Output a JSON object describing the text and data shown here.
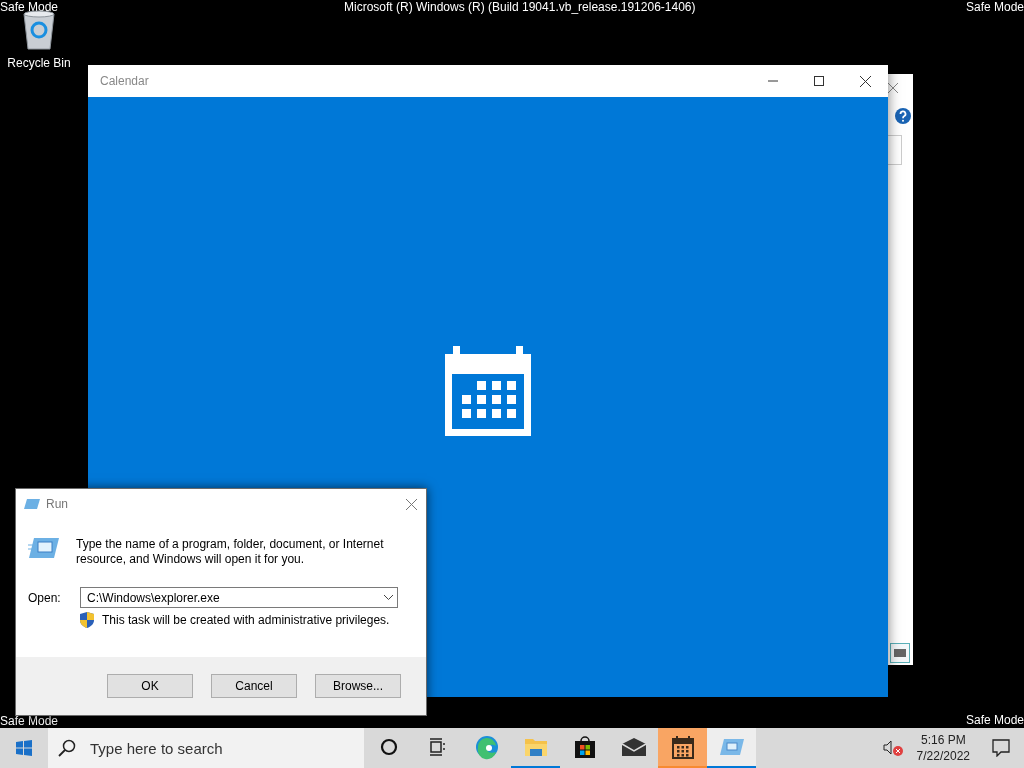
{
  "desktop": {
    "corner_labels": [
      "Safe Mode",
      "Safe Mode",
      "Safe Mode",
      "Safe Mode"
    ],
    "build_text": "Microsoft (R) Windows (R) (Build 19041.vb_release.191206-1406)",
    "icons": [
      {
        "label": "Recycle Bin"
      }
    ]
  },
  "calendar_window": {
    "title": "Calendar"
  },
  "run_dialog": {
    "title": "Run",
    "message": "Type the name of a program, folder, document, or Internet resource, and Windows will open it for you.",
    "open_label": "Open:",
    "open_value": "C:\\Windows\\explorer.exe",
    "admin_note": "This task will be created with administrative privileges.",
    "buttons": [
      "OK",
      "Cancel",
      "Browse..."
    ]
  },
  "taskbar": {
    "search_placeholder": "Type here to search",
    "apps": [
      {
        "kind": "cortana",
        "running": false,
        "flashing": false,
        "selected": false
      },
      {
        "kind": "task-view",
        "running": false,
        "flashing": false,
        "selected": false
      },
      {
        "kind": "edge",
        "running": false,
        "flashing": false,
        "selected": false
      },
      {
        "kind": "explorer",
        "running": true,
        "flashing": false,
        "selected": false
      },
      {
        "kind": "store",
        "running": false,
        "flashing": false,
        "selected": false
      },
      {
        "kind": "mail",
        "running": false,
        "flashing": false,
        "selected": false
      },
      {
        "kind": "calendar",
        "running": true,
        "flashing": true,
        "selected": false
      },
      {
        "kind": "run",
        "running": true,
        "flashing": false,
        "selected": true
      }
    ],
    "volume": {
      "muted": true
    },
    "clock": {
      "time": "5:16 PM",
      "date": "7/22/2022"
    }
  }
}
